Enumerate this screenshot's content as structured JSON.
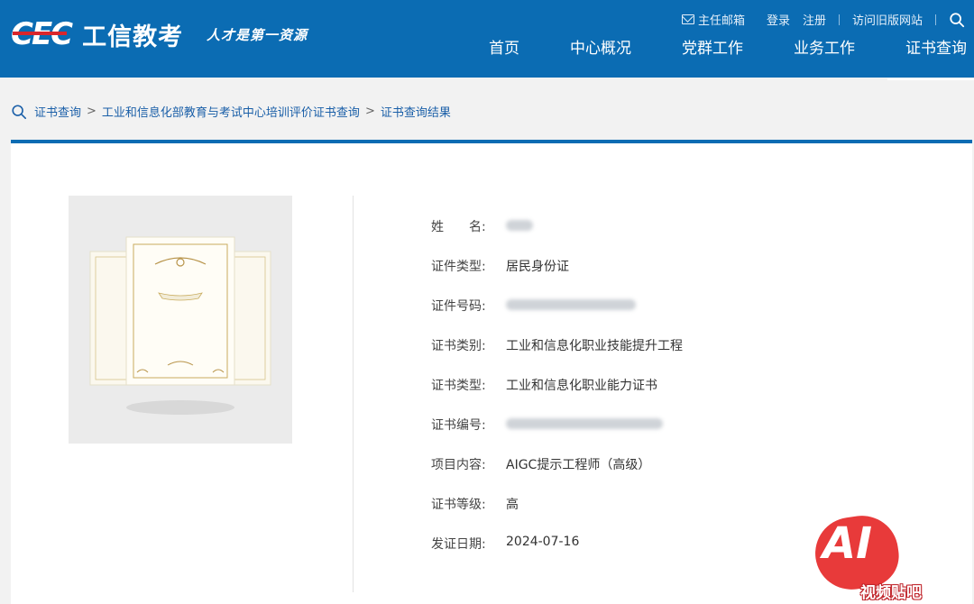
{
  "header": {
    "logo_mark": "CEC",
    "logo_name": "工信教考",
    "slogan": "人才是第一资源",
    "top_links": {
      "mail": "主任邮箱",
      "login": "登录",
      "register": "注册",
      "old_site": "访问旧版网站"
    },
    "nav": [
      {
        "label": "首页",
        "active": false
      },
      {
        "label": "中心概况",
        "active": false
      },
      {
        "label": "党群工作",
        "active": false
      },
      {
        "label": "业务工作",
        "active": false
      },
      {
        "label": "证书查询",
        "active": true
      }
    ]
  },
  "breadcrumb": [
    "证书查询",
    "工业和信息化部教育与考试中心培训评价证书查询",
    "证书查询结果"
  ],
  "result": {
    "fields": [
      {
        "label": "姓　　名:",
        "value": "",
        "blurred": true,
        "blur_width": 30
      },
      {
        "label": "证件类型:",
        "value": "居民身份证",
        "blurred": false
      },
      {
        "label": "证件号码:",
        "value": "",
        "blurred": true,
        "blur_width": 144
      },
      {
        "label": "证书类别:",
        "value": "工业和信息化职业技能提升工程",
        "blurred": false
      },
      {
        "label": "证书类型:",
        "value": "工业和信息化职业能力证书",
        "blurred": false
      },
      {
        "label": "证书编号:",
        "value": "",
        "blurred": true,
        "blur_width": 174
      },
      {
        "label": "项目内容:",
        "value": "AIGC提示工程师（高级）",
        "blurred": false
      },
      {
        "label": "证书等级:",
        "value": "高",
        "blurred": false
      },
      {
        "label": "发证日期:",
        "value": "2024-07-16",
        "blurred": false
      }
    ]
  },
  "watermark": {
    "big": "AI",
    "small": "视频贴吧"
  },
  "colors": {
    "brand_blue": "#0b6cb3",
    "accent_red": "#d9262c",
    "watermark_red": "#e83a3a"
  }
}
